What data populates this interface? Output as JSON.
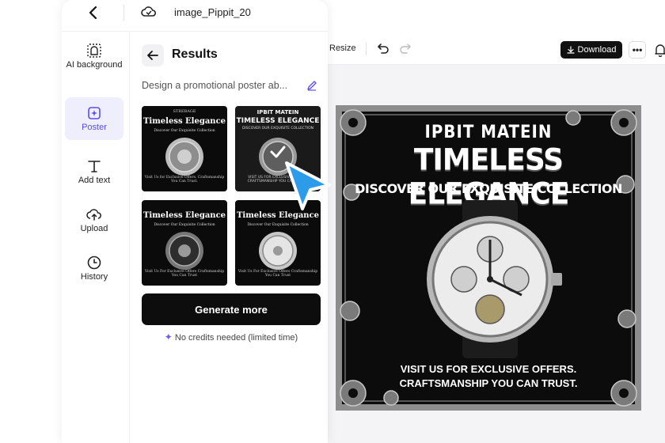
{
  "header": {
    "document_name": "image_Pippit_20"
  },
  "nav": {
    "items": [
      {
        "label": "AI background",
        "icon": "ai-background-icon"
      },
      {
        "label": "Poster",
        "icon": "poster-icon",
        "active": true
      },
      {
        "label": "Add text",
        "icon": "text-icon"
      },
      {
        "label": "Upload",
        "icon": "upload-icon"
      },
      {
        "label": "History",
        "icon": "history-icon"
      }
    ]
  },
  "results": {
    "title": "Results",
    "prompt": "Design a promotional poster ab...",
    "thumbnails": [
      {
        "small": "STREBAGE",
        "title": "Timeless Elegance",
        "sub": "Discover Our Exquisite Collection",
        "cta": "Visit Us for Exclusive Offers. Craftsmanship You Can Trust."
      },
      {
        "small": "IPBIT MATEIN",
        "title": "TIMELESS ELEGANCE",
        "sub": "DISCOVER OUR EXQUISITE COLLECTION",
        "cta": "VISIT US FOR EXCLUSIVE OFFERS. CRAFTSMANSHIP YOU CAN TRUST.",
        "selected": true
      },
      {
        "small": "",
        "title": "Timeless Elegance",
        "sub": "Discover Our Exquisite Collection",
        "cta": "Visit Us For Exclusive Offers Craftsmanship You Can Trust"
      },
      {
        "small": "",
        "title": "Timeless Elegance",
        "sub": "Discover Our Exquisite Collection",
        "cta": "Visit Us For Exclusive Offers Craftsmanship You Can Trust"
      }
    ],
    "generate_label": "Generate more",
    "credits_note": "No credits needed (limited time)"
  },
  "toolbar": {
    "resize_label": "Resize",
    "download_label": "Download",
    "more_label": "•••"
  },
  "poster": {
    "brand": "IPBIT MATEIN",
    "title": "TIMELESS ELEGANCE",
    "subtitle": "DISCOVER OUR EXQUISITE COLLECTION",
    "cta_line1": "VISIT US FOR EXCLUSIVE OFFERS.",
    "cta_line2": "CRAFTSMANSHIP YOU CAN TRUST."
  },
  "colors": {
    "accent": "#5b4cf0",
    "cursor": "#2b9bea",
    "primary_button": "#0d0d0d"
  }
}
